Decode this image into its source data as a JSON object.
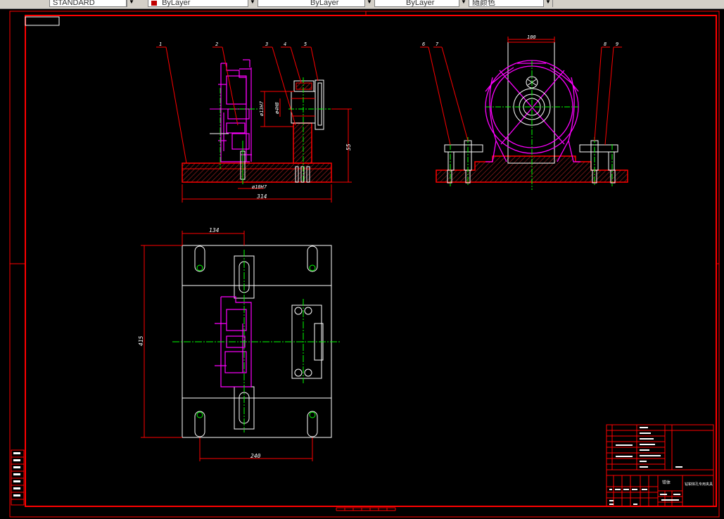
{
  "toolbar": {
    "style_value": "STANDARD",
    "color_value": "ByLayer",
    "linetype_value": "ByLayer",
    "lineweight_value": "ByLayer",
    "plotstyle_value": "随颜色"
  },
  "colors": {
    "border": "#ff0000",
    "outline": "#ffffff",
    "part": "#ff00ff",
    "center": "#00ff00",
    "hatch": "#8b1a1a",
    "text": "#ffffff",
    "dim_text": "#ffffff"
  },
  "drawing": {
    "front_view_balloons": [
      "1",
      "2",
      "3",
      "4",
      "5"
    ],
    "side_view_balloons": [
      "6",
      "7",
      "8",
      "9"
    ],
    "dim_front_width": "314",
    "dim_front_height": "55",
    "dim_bore_small": "ø10H7",
    "dim_pin_a": "ø13H7",
    "dim_pin_b": "ø4H8",
    "dim_side_top": "100",
    "dim_plan_top": "134",
    "dim_plan_height": "415",
    "dim_plan_bottom": "240"
  },
  "title_block": {
    "project_name": "钳体",
    "drawing_title": "钻钳体孔专用夹具",
    "scale_label": "比例"
  }
}
